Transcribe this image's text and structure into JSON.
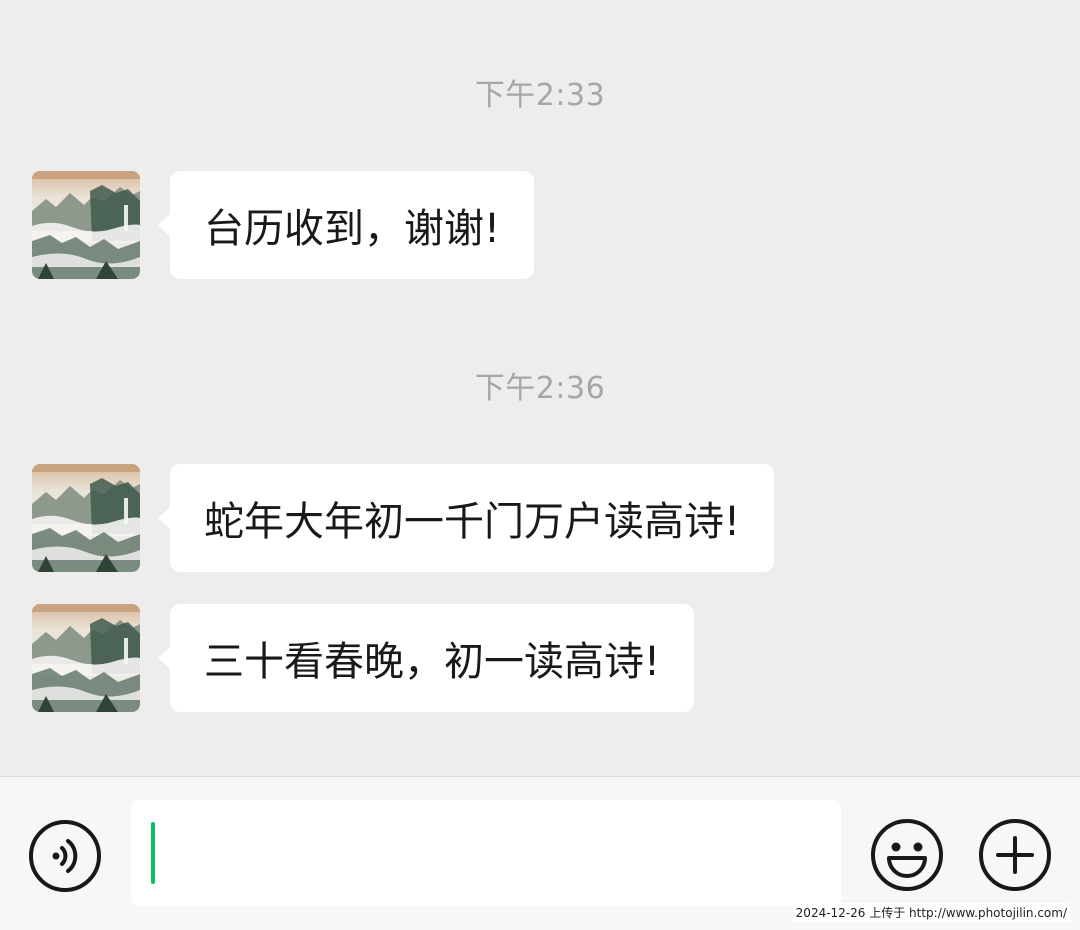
{
  "conversation": {
    "groups": [
      {
        "timestamp": "下午2:33",
        "messages": [
          {
            "text": "台历收到，谢谢!"
          }
        ]
      },
      {
        "timestamp": "下午2:36",
        "messages": [
          {
            "text": "蛇年大年初一千门万户读高诗!"
          },
          {
            "text": "三十看春晚，初一读高诗!"
          }
        ]
      }
    ]
  },
  "input_bar": {
    "value": "",
    "icons": {
      "voice": "voice-icon",
      "emoji": "emoji-icon",
      "more": "plus-icon"
    },
    "caret_color": "#07c160"
  },
  "watermark": "2024-12-26 上传于 http://www.photojilin.com/",
  "colors": {
    "background": "#ededed",
    "bubble": "#ffffff",
    "timestamp": "#a6a6a6"
  }
}
